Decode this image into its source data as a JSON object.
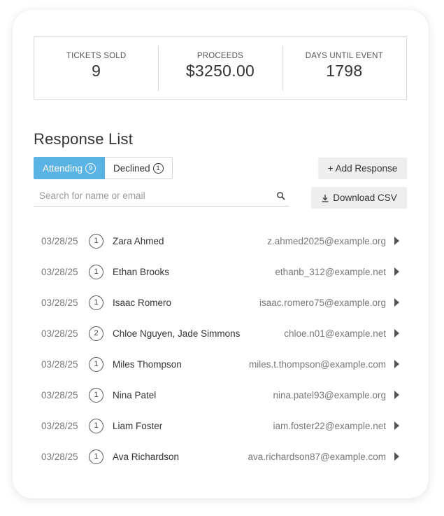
{
  "stats": [
    {
      "label": "TICKETS SOLD",
      "value": "9"
    },
    {
      "label": "PROCEEDS",
      "value": "$3250.00"
    },
    {
      "label": "DAYS UNTIL EVENT",
      "value": "1798"
    }
  ],
  "section_title": "Response List",
  "tabs": {
    "attending": {
      "label": "Attending",
      "count": "9"
    },
    "declined": {
      "label": "Declined",
      "count": "1"
    }
  },
  "buttons": {
    "add_response": "+ Add Response",
    "download_csv": "Download CSV"
  },
  "search": {
    "placeholder": "Search for name or email",
    "value": ""
  },
  "colors": {
    "accent": "#5bb2e4",
    "button_bg": "#eeeeee"
  },
  "responses": [
    {
      "date": "03/28/25",
      "count": "1",
      "name": "Zara Ahmed",
      "email": "z.ahmed2025@example.org"
    },
    {
      "date": "03/28/25",
      "count": "1",
      "name": "Ethan Brooks",
      "email": "ethanb_312@example.net"
    },
    {
      "date": "03/28/25",
      "count": "1",
      "name": "Isaac Romero",
      "email": "isaac.romero75@example.org"
    },
    {
      "date": "03/28/25",
      "count": "2",
      "name": "Chloe Nguyen, Jade Simmons",
      "email": "chloe.n01@example.net"
    },
    {
      "date": "03/28/25",
      "count": "1",
      "name": "Miles Thompson",
      "email": "miles.t.thompson@example.com"
    },
    {
      "date": "03/28/25",
      "count": "1",
      "name": "Nina Patel",
      "email": "nina.patel93@example.org"
    },
    {
      "date": "03/28/25",
      "count": "1",
      "name": "Liam Foster",
      "email": "iam.foster22@example.net"
    },
    {
      "date": "03/28/25",
      "count": "1",
      "name": "Ava Richardson",
      "email": "ava.richardson87@example.com"
    }
  ]
}
